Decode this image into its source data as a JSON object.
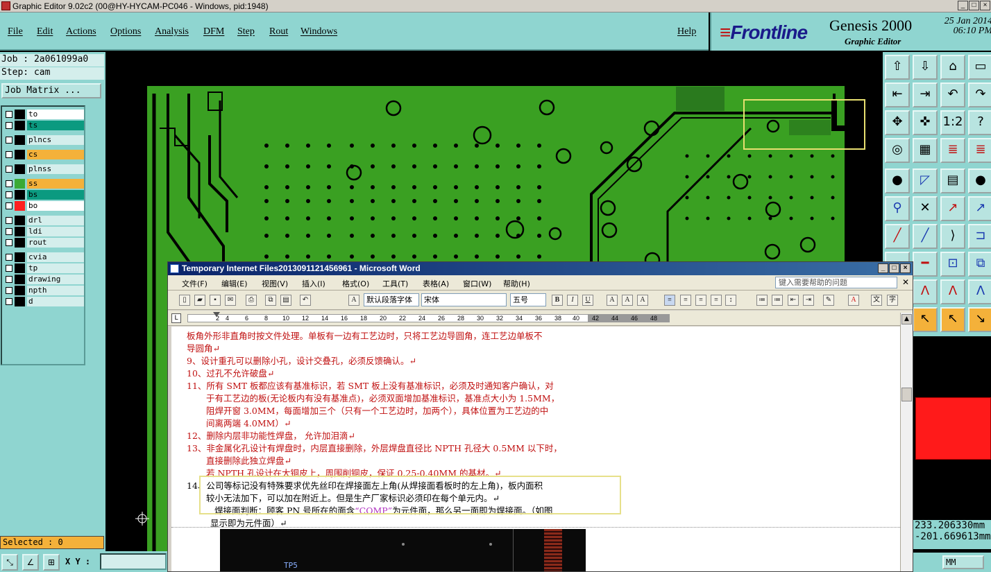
{
  "window": {
    "title": "Graphic Editor 9.02c2 (00@HY-HYCAM-PC046 - Windows, pid:1948)"
  },
  "menu": [
    "File",
    "Edit",
    "Actions",
    "Options",
    "Analysis",
    "DFM",
    "Step",
    "Rout",
    "Windows"
  ],
  "help_label": "Help",
  "brand": {
    "logo": "Frontline",
    "product": "Genesis 2000",
    "subtitle": "Graphic Editor",
    "date": "25 Jan 2014",
    "time": "06:10 PM"
  },
  "job": {
    "job_line": "Job : 2a061099a0",
    "step_line": "Step: cam",
    "job_matrix_label": "Job Matrix ..."
  },
  "layers": [
    {
      "name": "to",
      "color": "#ffffff",
      "swatch": "#000000"
    },
    {
      "name": "ts",
      "color": "#0b9a80",
      "swatch": "#000000"
    },
    {
      "name": "plncs",
      "color": "#d4eeec",
      "swatch": "#000000"
    },
    {
      "name": "cs",
      "color": "#f4b13a",
      "swatch": "#000000"
    },
    {
      "name": "plnss",
      "color": "#d4eeec",
      "swatch": "#000000"
    },
    {
      "name": "ss",
      "color": "#f4b13a",
      "swatch": "#3aaa35"
    },
    {
      "name": "bs",
      "color": "#0b9a80",
      "swatch": "#000000"
    },
    {
      "name": "bo",
      "color": "#ffffff",
      "swatch": "#ff2020"
    },
    {
      "name": "drl",
      "color": "#d4eeec",
      "swatch": "#000000"
    },
    {
      "name": "ldi",
      "color": "#d4eeec",
      "swatch": "#000000"
    },
    {
      "name": "rout",
      "color": "#d4eeec",
      "swatch": "#000000"
    },
    {
      "name": "cvia",
      "color": "#d4eeec",
      "swatch": "#000000"
    },
    {
      "name": "tp",
      "color": "#d4eeec",
      "swatch": "#000000"
    },
    {
      "name": "drawing",
      "color": "#d4eeec",
      "swatch": "#000000"
    },
    {
      "name": "npth",
      "color": "#d4eeec",
      "swatch": "#000000"
    },
    {
      "name": "d",
      "color": "#d4eeec",
      "swatch": "#000000"
    }
  ],
  "selected": "Selected : 0",
  "xy_label": "X Y :",
  "coords": {
    "x": "233.206330mm",
    "y": "-201.669613mm"
  },
  "units": "MM",
  "word": {
    "title": "Temporary Internet Files2013091121456961 - Microsoft Word",
    "menu": [
      "文件(F)",
      "编辑(E)",
      "视图(V)",
      "插入(I)",
      "格式(O)",
      "工具(T)",
      "表格(A)",
      "窗口(W)",
      "帮助(H)"
    ],
    "help_placeholder": "键入需要帮助的问题",
    "style_combo": "默认段落字体",
    "font_combo": "宋体",
    "size_combo": "五号",
    "ruler": [
      "2",
      "2",
      "4",
      "6",
      "8",
      "10",
      "12",
      "14",
      "16",
      "18",
      "20",
      "22",
      "24",
      "26",
      "28",
      "30",
      "32",
      "34",
      "36",
      "38",
      "40",
      "42",
      "44",
      "46",
      "48"
    ],
    "lines": [
      "板角外形非直角时按文件处理。单板有一边有工艺边时，只将工艺边导圆角，连工艺边单板不",
      "导圆角↵",
      "9、设计重孔可以删除小孔，设计交叠孔，必须反馈确认。↵",
      "10、过孔不允许破盘↵",
      "11、所有 SMT 板都应该有基准标识，若 SMT 板上没有基准标识，必须及时通知客户确认，对",
      "于有工艺边的板(无论板内有没有基准点)，必须双面增加基准标识，基准点大小为 1.5MM，",
      "阻焊开窗 3.0MM，每面增加三个（只有一个工艺边时，加两个），具体位置为工艺边的中",
      "间离两端 4.0MM）↵",
      "12、删除内层非功能性焊盘，  允许加泪滴↵",
      "13、非金属化孔设计有焊盘时，内层直接删除，外层焊盘直径比 NPTH 孔径大 0.5MM 以下时，",
      "直接删除此独立焊盘↵",
      "若 NPTH 孔设计在大铜皮上，周围削铜皮，保证 0.25-0.40MM 的基材。↵",
      "14、公司等标记没有特殊要求优先丝印在焊接面左上角(从焊接面看板时的左上角)，板内面积",
      "较小无法加下，可以加在附近上。但是生产厂家标识必须印在每个单元内。↵",
      "焊接面判断：顾客 PN 号所在的面含",
      "“COMP”",
      "为元件面，那么另一面即为焊接面。（如图",
      "显示即为元件面）↵"
    ],
    "image_label": "TP5"
  }
}
